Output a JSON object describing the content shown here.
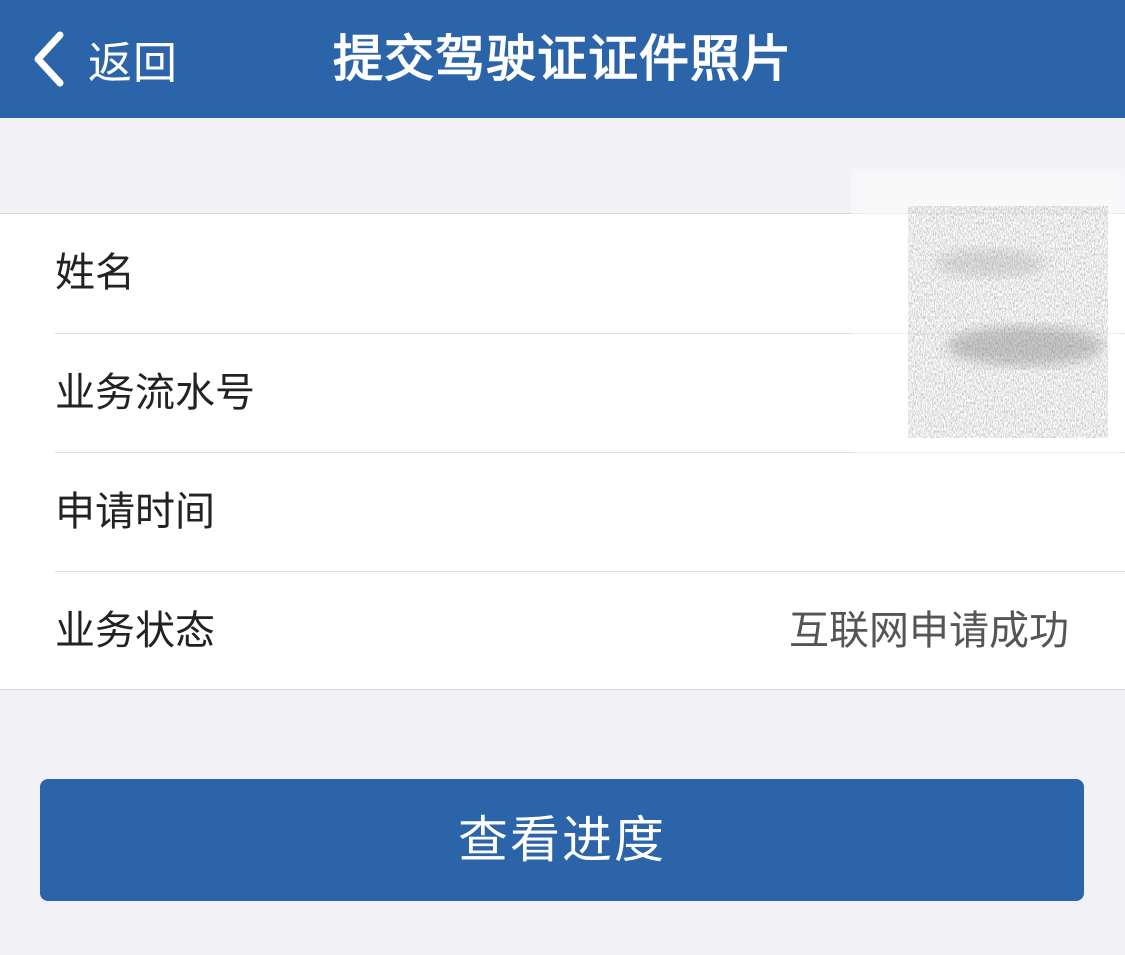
{
  "navbar": {
    "back_label": "返回",
    "title": "提交驾驶证证件照片",
    "background": "#2c64a9"
  },
  "info": {
    "rows": [
      {
        "label": "姓名",
        "value": ""
      },
      {
        "label": "业务流水号",
        "value": ""
      },
      {
        "label": "申请时间",
        "value": ""
      },
      {
        "label": "业务状态",
        "value": "互联网申请成功"
      }
    ]
  },
  "actions": {
    "progress_label": "查看进度"
  },
  "colors": {
    "accent": "#2c64a9",
    "page_background": "#f2f2f6"
  }
}
